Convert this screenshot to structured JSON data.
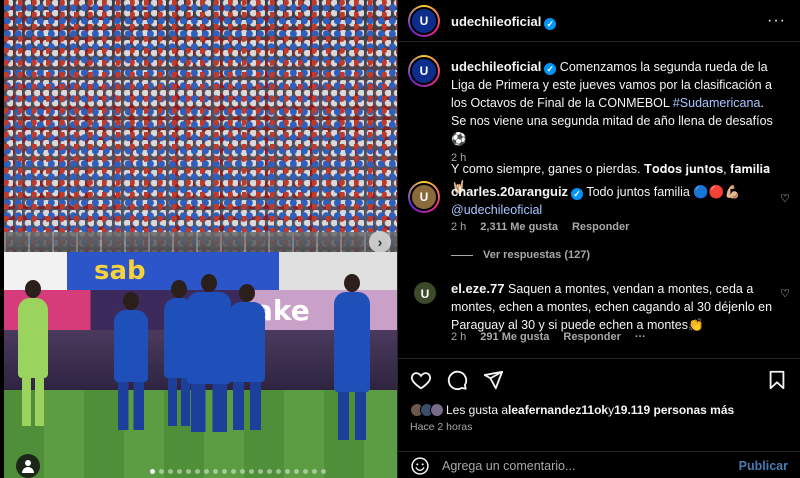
{
  "photo": {
    "banner_top_text": "sab",
    "banner_mid_text": "ake",
    "next_arrow": "›"
  },
  "post": {
    "username": "udechileoficial",
    "more": "···",
    "caption_username": "udechileoficial",
    "caption_line1": "Comenzamos la segunda rueda de la Liga de Primera y este jueves vamos por la clasificación a los Octavos de Final de la CONMEBOL ",
    "caption_hashtag": "#Sudamericana",
    "caption_line1_end": ".",
    "caption_line2": "Se nos viene una segunda mitad de año llena de desafíos ⚽",
    "caption_line3": "Y como siempre, ganes o pierdas. 𝐓𝐨𝐝𝐨𝐬 𝐣𝐮𝐧𝐭𝐨𝐬, 𝐟𝐚𝐦𝐢𝐥𝐢𝐚 🤘🏼",
    "caption_time": "2 h"
  },
  "comments": [
    {
      "username": "charles.20aranguiz",
      "text": "Todo juntos familia 🔵🔴💪🏼",
      "mention": "@udechileoficial",
      "time": "2 h",
      "likes": "2,311 Me gusta",
      "reply": "Responder",
      "view_replies": "Ver respuestas (127)"
    },
    {
      "username": "el.eze.77",
      "text": "Saquen a montes, vendan a montes, ceda a montes, echen a montes, echen cagando al 30 déjenlo en Paraguay al 30 y si puede echen a montes👏",
      "time": "2 h",
      "likes": "291 Me gusta",
      "reply": "Responder",
      "more": "···"
    }
  ],
  "footer": {
    "likes_prefix": "Les gusta a ",
    "likes_user": "leafernandez11ok",
    "likes_mid": " y ",
    "likes_count": "19.119 personas más",
    "date": "Hace 2 horas",
    "comment_placeholder": "Agrega un comentario...",
    "publish": "Publicar"
  }
}
